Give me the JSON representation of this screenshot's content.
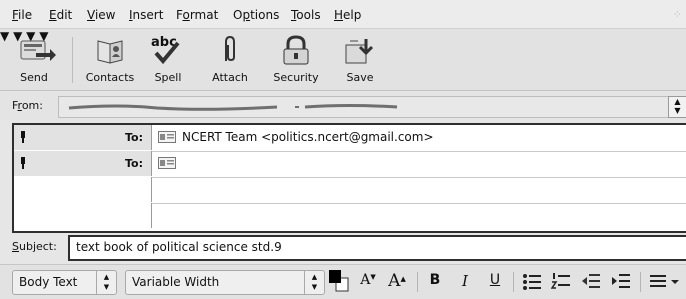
{
  "menubar": {
    "items": [
      {
        "label": "File",
        "mnemonic": "F"
      },
      {
        "label": "Edit",
        "mnemonic": "E"
      },
      {
        "label": "View",
        "mnemonic": "V"
      },
      {
        "label": "Insert",
        "mnemonic": "I"
      },
      {
        "label": "Format",
        "mnemonic": "o"
      },
      {
        "label": "Options",
        "mnemonic": "p"
      },
      {
        "label": "Tools",
        "mnemonic": "T"
      },
      {
        "label": "Help",
        "mnemonic": "H"
      }
    ]
  },
  "toolbar": {
    "send": "Send",
    "contacts": "Contacts",
    "spell": "Spell",
    "spell_glyph": "abc",
    "attach": "Attach",
    "security": "Security",
    "save": "Save"
  },
  "header": {
    "from_label": "From:",
    "to_label": "To:",
    "subject_label": "Subject:",
    "subject_value": "text book of political science std.9",
    "recipients": [
      {
        "type": "To:",
        "value": "NCERT Team <politics.ncert@gmail.com>"
      },
      {
        "type": "To:",
        "value": ""
      },
      {
        "type": "",
        "value": ""
      },
      {
        "type": "",
        "value": ""
      }
    ]
  },
  "formatbar": {
    "paragraph_style": "Body Text",
    "font_family": "Variable Width",
    "smaller_glyph": "A",
    "larger_glyph": "A",
    "bold_glyph": "B",
    "italic_glyph": "I",
    "underline_glyph": "U"
  },
  "icons": {
    "send": "send-icon",
    "contacts": "address-book-icon",
    "spell": "spellcheck-icon",
    "attach": "paperclip-icon",
    "security": "padlock-icon",
    "save": "save-icon",
    "priority": "pushpin-icon",
    "contact_card": "contact-card-icon",
    "bullets": "bullet-list-icon",
    "numbers": "numbered-list-icon",
    "outdent": "outdent-icon",
    "indent": "indent-icon",
    "align": "align-icon"
  }
}
